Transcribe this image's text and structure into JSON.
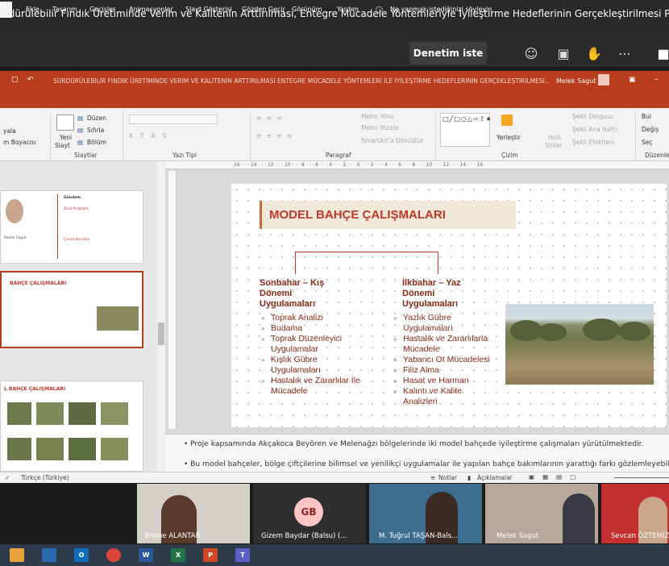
{
  "meeting": {
    "title": "rdürülebilir Fındık Üretiminde Verim ve Kalitenin Arttırılması, Entegre Mücadele Yöntemleriyle İyileştirme Hedeflerinin Gerçekleştirilmesi Projesi Yıl Sonu Değerlendirm",
    "present_button": "Denetim iste"
  },
  "ppt": {
    "window_title": "SÜRDÜRÜLEBİLİR FINDIK ÜRETİMİNDE VERİM VE KALİTENİN ARTTIRILMASI ENTEGRE MÜCADELE YÖNTEMLERİ İLE İYİLEŞTİRME HEDEFLERİNİN GERÇEKLEŞTİRİLMESİ...",
    "user_name": "Melek Sagut",
    "tabs": [
      "Ekle",
      "Tasarım",
      "Geçişler",
      "Animasyonlar",
      "Slayt Gösterisi",
      "Gözden Geçir",
      "Görünüm",
      "Yardım",
      "Ne yapmak istediğinizi söyleyin"
    ],
    "ribbon": {
      "paste_frag": "yala",
      "format_painter_frag": "m Boyacısı",
      "new_slide_1": "Yeni",
      "new_slide_2": "Slayt",
      "layout": "Düzen",
      "reset": "Sıfırla",
      "section": "Bölüm",
      "text_direction": "Metin Yönü",
      "align_text": "Metni Hizala",
      "smartart": "SmartArt'a Dönüştür",
      "arrange": "Yerleştir",
      "quick_styles_1": "Hızlı",
      "quick_styles_2": "Stiller",
      "shape_fill": "Şekil Dolgusu",
      "shape_outline": "Şekil Ana Hattı",
      "shape_effects": "Şekil Efektleri",
      "find": "Bul",
      "replace": "Değiş",
      "select": "Seç",
      "group_slides": "Slaytlar",
      "group_font": "Yazı Tipi",
      "group_paragraph": "Paragraf",
      "group_drawing": "Çizim",
      "group_editing": "Düzenle"
    },
    "ruler_text": "16 · · · 14 · · · 12 · · · 10 · · · 8 · · · 6 · · · 4 · · · 2 · · · 0 · · · 2 · · · 4 · · · 6 · · · 8 · · · 10 · · · 12 · · · 14 · · · 16",
    "thumbnails": {
      "t1_agenda": "Gündem",
      "t1_item1": "Zirai Program",
      "t1_item2": "Çevre Koruma",
      "t1_name": "Melek Sagut",
      "t2_title": "BAHÇE ÇALIŞMALARI",
      "t3_title": "L BAHÇE ÇALIŞMALARI"
    },
    "slide": {
      "title": "MODEL BAHÇE ÇALIŞMALARI",
      "left_heading": [
        "Sonbahar – Kış",
        "Dönemi",
        "Uygulamaları"
      ],
      "left_items": [
        "Toprak Analizi",
        "Budama",
        "Toprak Düzenleyici",
        "Uygulamalar",
        "Kışlık Gübre",
        "Uygulamaları",
        "Hastalık ve Zararlılar İle",
        "Mücadele"
      ],
      "left_bullets": [
        true,
        true,
        true,
        false,
        true,
        false,
        true,
        false
      ],
      "right_heading": [
        "İlkbahar – Yaz",
        "Dönemi",
        "Uygulamaları"
      ],
      "right_items": [
        "Yazlık Gübre",
        "Uygulamaları",
        "Hastalık ve Zararlılarla",
        "Mücadele",
        "Yabancı Ot Mücadelesi",
        "Filiz Alma",
        "Hasat ve Harman",
        "Kalıntı ve Kalite",
        "Analizleri"
      ],
      "right_bullets": [
        true,
        false,
        true,
        false,
        true,
        true,
        true,
        true,
        false
      ]
    },
    "notes": [
      "Proje kapsamında Akçakoca Beyören ve Melenağzı bölgelerinde iki model bahçede iyileştirme çalışmaları yürütülmektedir.",
      "Bu model bahçeler, bölge çiftçilerine bilimsel ve yenilikçi uygulamalar ile yapılan bahçe bakımlarının yarattığı farkı gözlemleyebilmele"
    ],
    "status": {
      "language": "Türkçe (Türkiye)",
      "notes_btn": "Notlar",
      "comments_btn": "Açıklamalar"
    }
  },
  "participants": [
    {
      "name": "Emine ALANTAR"
    },
    {
      "name": "Gizem Baydar (Balsu) (...",
      "initials": "GB"
    },
    {
      "name": "M. Tuğrul TAŞAN-Bals..."
    },
    {
      "name": "Melek Sagut"
    },
    {
      "name": "Sevcan ÖZTEMİZ"
    }
  ],
  "taskbar": [
    "O",
    "W",
    "X",
    "P",
    "T"
  ],
  "colors": {
    "ppt_accent": "#b83c1e",
    "slide_title": "#c0392b",
    "slide_text": "#8a2a14"
  }
}
